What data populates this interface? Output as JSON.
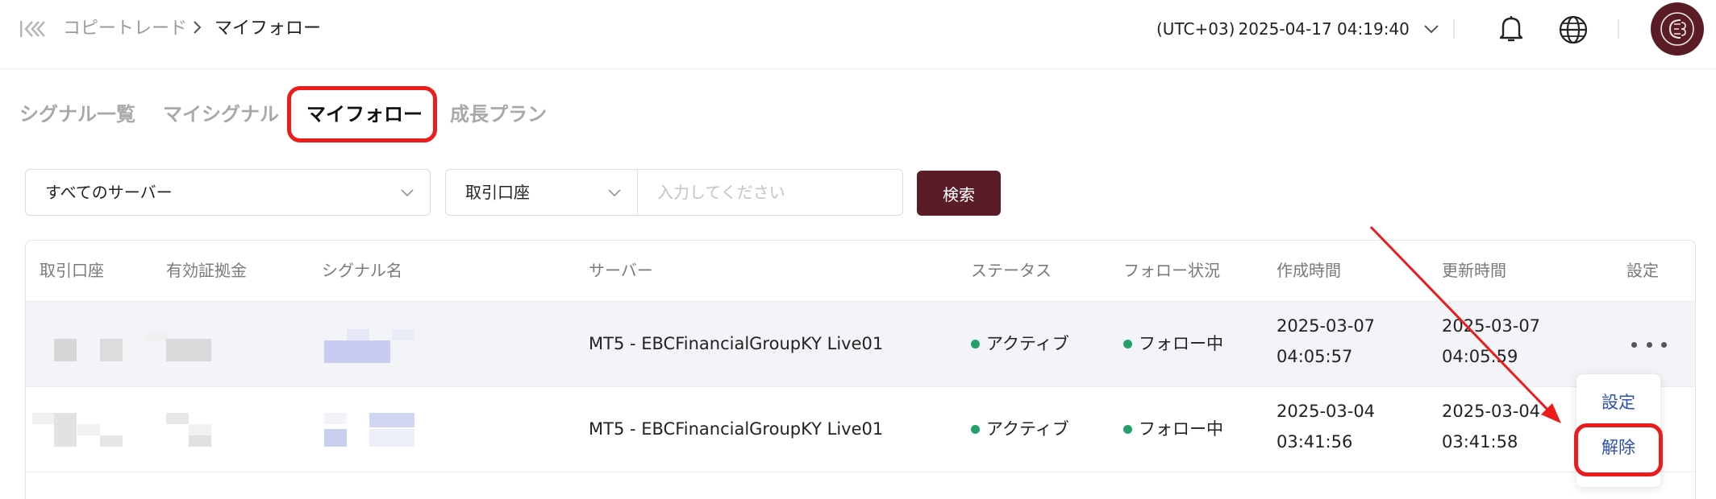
{
  "header": {
    "breadcrumb_parent": "コピートレード",
    "breadcrumb_current": "マイフォロー",
    "timezone": "(UTC+03)",
    "datetime": "2025-04-17 04:19:40",
    "brand_color": "#5a1c26"
  },
  "tabs": [
    {
      "label": "シグナル一覧",
      "active": false
    },
    {
      "label": "マイシグナル",
      "active": false
    },
    {
      "label": "マイフォロー",
      "active": true
    },
    {
      "label": "成長プラン",
      "active": false
    }
  ],
  "filters": {
    "server_select": "すべてのサーバー",
    "account_type_select": "取引口座",
    "account_input_value": "",
    "account_input_placeholder": "入力してください",
    "search_button": "検索"
  },
  "table": {
    "columns": [
      "取引口座",
      "有効証拠金",
      "シグナル名",
      "サーバー",
      "ステータス",
      "フォロー状況",
      "作成時間",
      "更新時間",
      "設定"
    ],
    "rows": [
      {
        "server": "MT5 - EBCFinancialGroupKY Live01",
        "status": "アクティブ",
        "follow_status": "フォロー中",
        "created_date": "2025-03-07",
        "created_time": "04:05:57",
        "updated_date": "2025-03-07",
        "updated_time": "04:05:59"
      },
      {
        "server": "MT5 - EBCFinancialGroupKY Live01",
        "status": "アクティブ",
        "follow_status": "フォロー中",
        "created_date": "2025-03-04",
        "created_time": "03:41:56",
        "updated_date": "2025-03-04",
        "updated_time": "03:41:58"
      }
    ]
  },
  "menu": {
    "settings": "設定",
    "unfollow": "解除"
  },
  "colors": {
    "status_green": "#22a06b",
    "annotation_red": "#ec1c1c",
    "link_blue": "#2f4fb0"
  }
}
